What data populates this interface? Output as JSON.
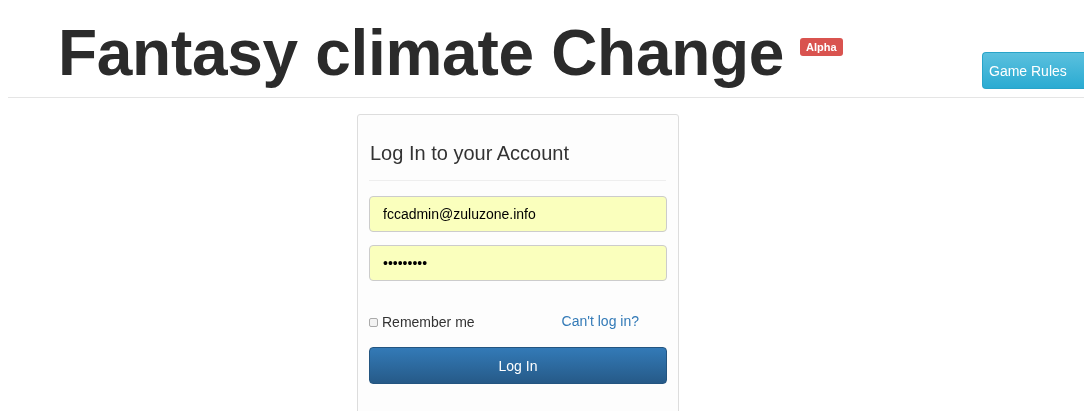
{
  "header": {
    "title": "Fantasy climate Change",
    "badge": "Alpha",
    "button": "Game Rules"
  },
  "login": {
    "heading": "Log In to your Account",
    "email": {
      "value": "fccadmin@zuluzone.info"
    },
    "password": {
      "value": "•••••••••"
    },
    "remember": {
      "label": "Remember me",
      "checked": false
    },
    "forgot_link": "Can't log in?",
    "submit": "Log In"
  }
}
